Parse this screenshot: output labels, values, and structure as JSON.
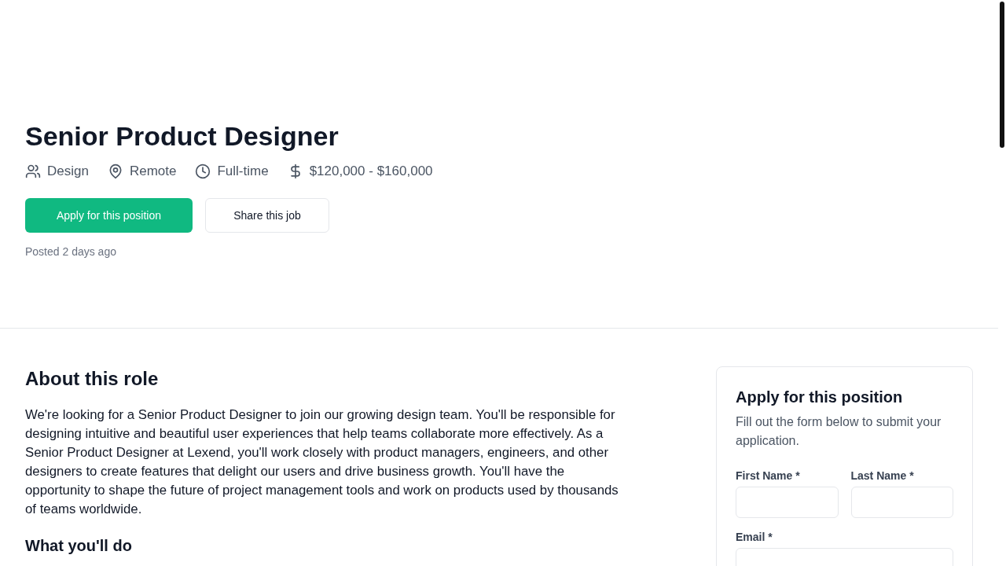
{
  "job": {
    "title": "Senior Product Designer",
    "meta": [
      {
        "kind": "team",
        "label": "Design"
      },
      {
        "kind": "location",
        "label": "Remote"
      },
      {
        "kind": "time",
        "label": "Full-time"
      },
      {
        "kind": "salary",
        "label": "$120,000 - $160,000"
      }
    ],
    "apply_button": "Apply for this position",
    "share_button": "Share this job",
    "posted": "Posted 2 days ago"
  },
  "about": {
    "heading": "About this role",
    "paragraph": "We're looking for a Senior Product Designer to join our growing design team. You'll be responsible for designing intuitive and beautiful user experiences that help teams collaborate more effectively. As a Senior Product Designer at Lexend, you'll work closely with product managers, engineers, and other designers to create features that delight our users and drive business growth. You'll have the opportunity to shape the future of project management tools and work on products used by thousands of teams worldwide.",
    "next_heading": "What you'll do"
  },
  "form": {
    "title": "Apply for this position",
    "subtitle": "Fill out the form below to submit your application.",
    "fields": [
      {
        "label": "First Name *",
        "kind": "half"
      },
      {
        "label": "Last Name *",
        "kind": "half"
      },
      {
        "label": "Email *",
        "kind": "full"
      }
    ]
  }
}
